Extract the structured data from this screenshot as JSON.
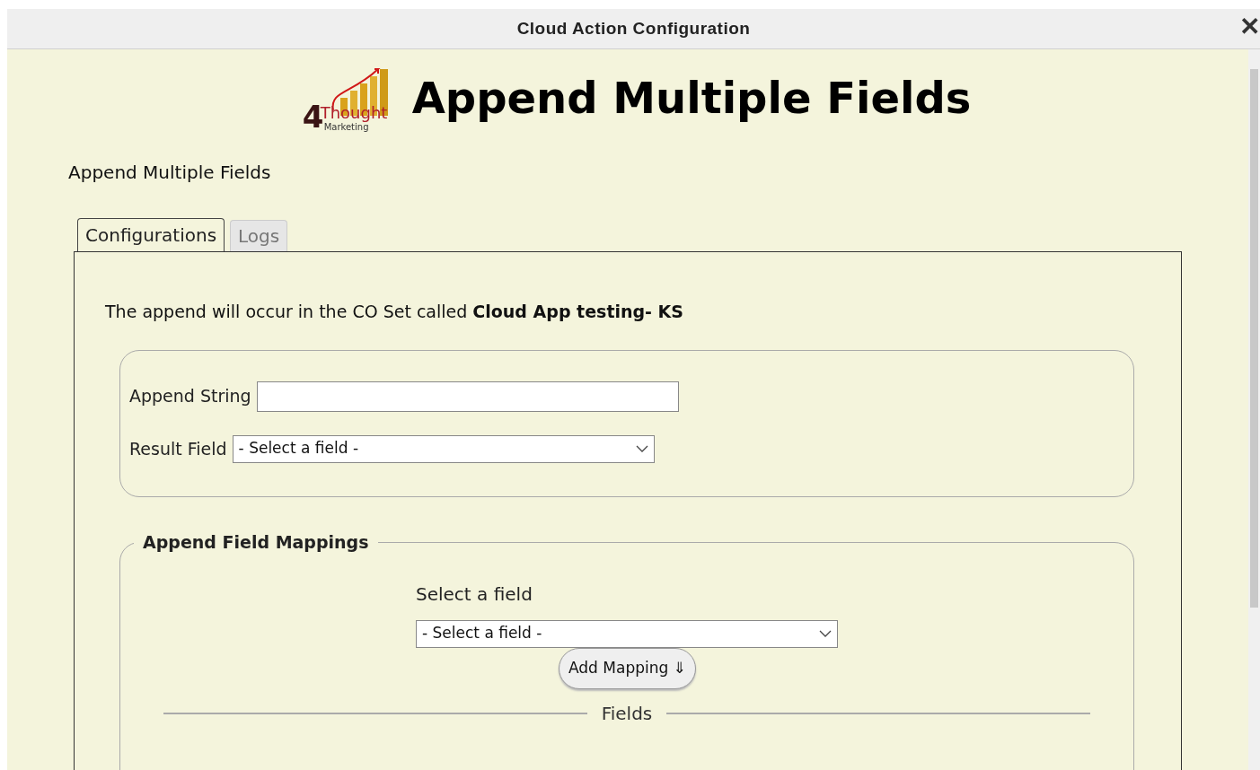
{
  "window": {
    "title": "Cloud Action Configuration",
    "close": "✕"
  },
  "logo": {
    "numeral": "4",
    "word": "Thought",
    "sub": "Marketing"
  },
  "heading": "Append Multiple Fields",
  "subheading": "Append Multiple Fields",
  "tabs": [
    {
      "label": "Configurations",
      "selected": true
    },
    {
      "label": "Logs",
      "selected": false
    }
  ],
  "intro": "The append will occur in the CO Set called **Cloud App testing- KS**",
  "append_string": {
    "label": "Append String"
  },
  "result_field": {
    "label": "Result Field",
    "value": "- Select a field -"
  },
  "mappings": {
    "legend": "Append Field Mappings",
    "select_label": "Select a field",
    "select_value": "- Select a field -",
    "button": "Add Mapping ⇓",
    "fields_divider": "Fields"
  }
}
